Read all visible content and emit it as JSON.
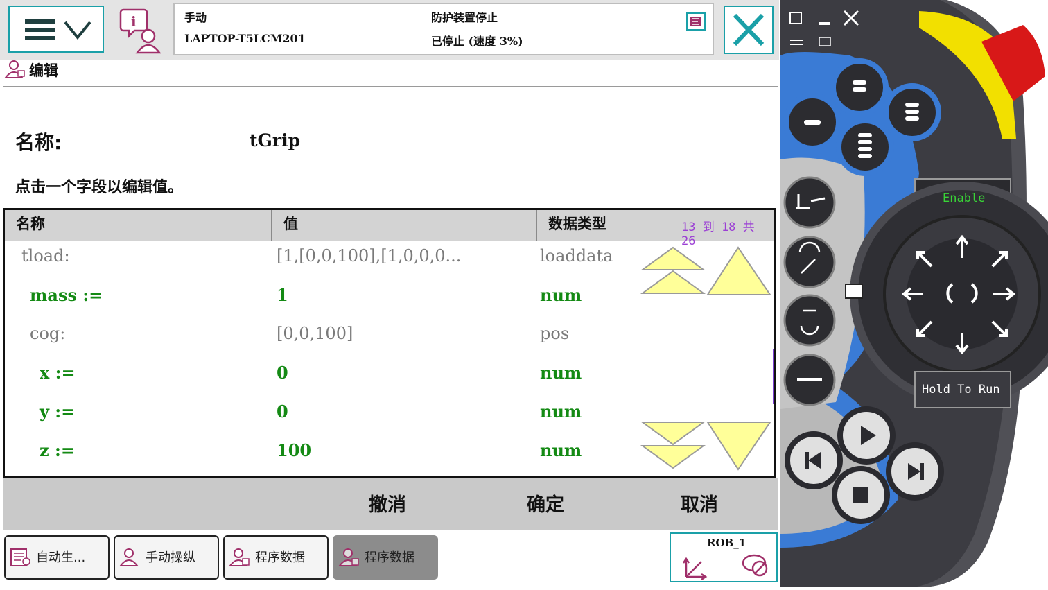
{
  "status": {
    "mode": "手动",
    "controller": "LAPTOP-T5LCM201",
    "state": "防护装置停止",
    "speed": "已停止 (速度 3%)"
  },
  "editor": {
    "title": "编辑",
    "name_label": "名称:",
    "name_value": "tGrip",
    "hint": "点击一个字段以编辑值。",
    "columns": [
      "名称",
      "值",
      "数据类型"
    ],
    "page_count": "13 到 18 共 26",
    "rows": [
      {
        "name": "tload:",
        "value": "[1,[0,0,100],[1,0,0,0...",
        "type": "loaddata"
      },
      {
        "name": "mass :=",
        "value": "1",
        "type": "num"
      },
      {
        "name": "cog:",
        "value": "[0,0,100]",
        "type": "pos"
      },
      {
        "name": "x :=",
        "value": "0",
        "type": "num"
      },
      {
        "name": "y :=",
        "value": "0",
        "type": "num"
      },
      {
        "name": "z :=",
        "value": "100",
        "type": "num"
      }
    ],
    "actions": {
      "undo": "撤消",
      "ok": "确定",
      "cancel": "取消"
    }
  },
  "taskbar": {
    "items": [
      "自动生...",
      "手动操纵",
      "程序数据",
      "程序数据"
    ],
    "rob": "ROB_1"
  },
  "pendant": {
    "enable": "Enable",
    "hold_to_run": "Hold To Run"
  },
  "colors": {
    "accent": "#1aa0a8",
    "editable_green": "#148a14",
    "readonly_gray": "#7a7a7a",
    "page_count_purple": "#9b3fd4",
    "scroll_yellow": "#ffff99",
    "pendant_blue": "#3a7bd5"
  }
}
